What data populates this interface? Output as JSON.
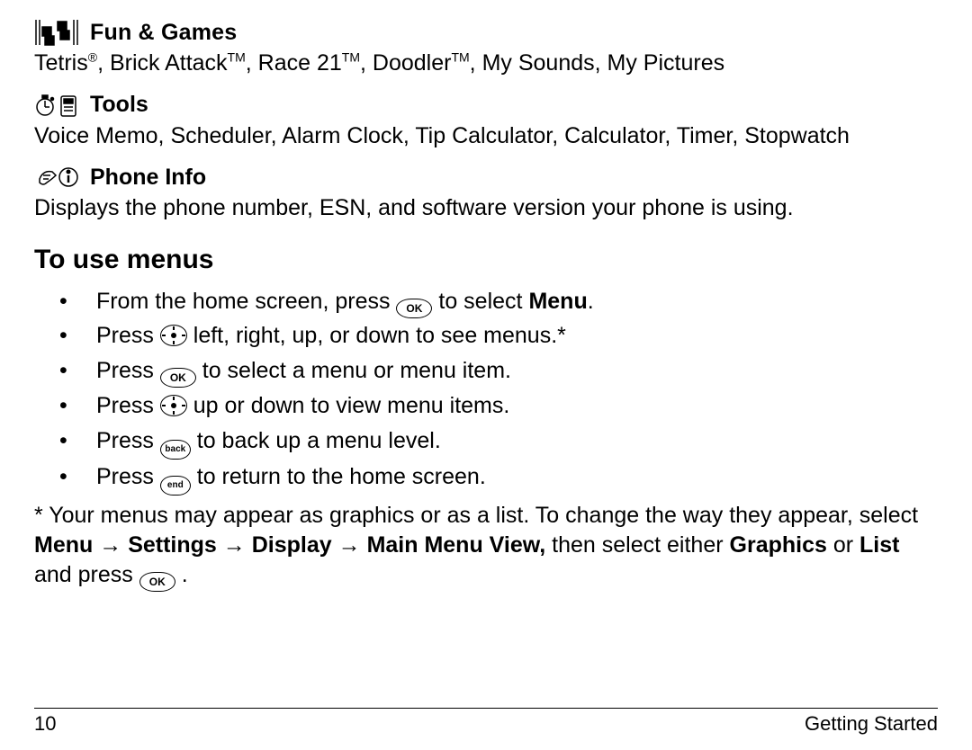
{
  "sections": {
    "fun_games": {
      "title": "Fun & Games",
      "body_html": "Tetris<sup>®</sup>, Brick Attack<sup>TM</sup>, Race 21<sup>TM</sup>, Doodler<sup>TM</sup>, My Sounds, My Pictures"
    },
    "tools": {
      "title": "Tools",
      "body": "Voice Memo, Scheduler, Alarm Clock, Tip Calculator, Calculator, Timer, Stopwatch"
    },
    "phone_info": {
      "title": "Phone Info",
      "body": "Displays the phone number, ESN, and software version your phone is using."
    }
  },
  "heading": "To use menus",
  "bullets": {
    "b1_pre": "From the home screen, press ",
    "b1_post": " to  select ",
    "b1_bold": "Menu",
    "b2_pre": "Press ",
    "b2_post": " left, right, up, or down to see menus.*",
    "b3_pre": "Press ",
    "b3_post": " to select a menu or menu item.",
    "b4_pre": "Press ",
    "b4_post": " up or down to view menu items.",
    "b5_pre": "Press ",
    "b5_post": " to back up a menu level.",
    "b6_pre": "Press ",
    "b6_post": " to return to the home screen."
  },
  "keys": {
    "ok": "OK",
    "back": "back",
    "end": "end"
  },
  "note": {
    "pre": "* Your menus may appear as graphics or as a list. To change the way they appear, select ",
    "path1": "Menu",
    "path2": "Settings",
    "path3": "Display",
    "path4": "Main Menu View,",
    "mid": " then select either ",
    "opt1": "Graphics",
    "or": " or ",
    "opt2": "List",
    "post": " and press "
  },
  "footer": {
    "page": "10",
    "chapter": "Getting Started"
  }
}
